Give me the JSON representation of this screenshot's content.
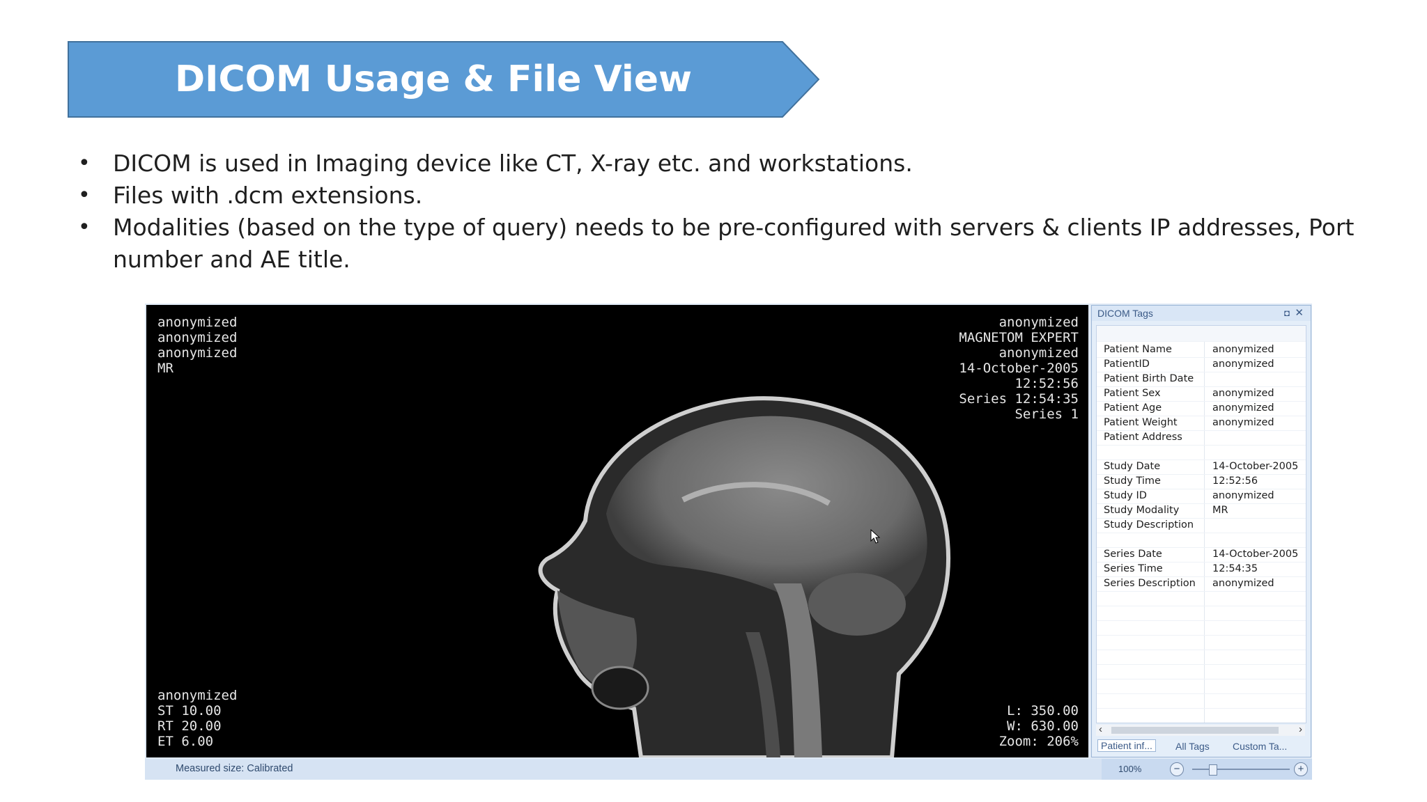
{
  "slide": {
    "title": "DICOM Usage & File View",
    "bullets": [
      "DICOM is used in Imaging device like CT, X-ray etc. and workstations.",
      "Files with .dcm extensions.",
      "Modalities (based on the type of query) needs to be pre-configured with servers & clients IP addresses, Port number and AE title."
    ],
    "banner_color": "#5b9bd5"
  },
  "viewer": {
    "overlay_top_left": "anonymized\nanonymized\nanonymized\nMR",
    "overlay_top_right": "anonymized\nMAGNETOM EXPERT\nanonymized\n14-October-2005\n12:52:56\nSeries 12:54:35\nSeries 1",
    "overlay_bottom_left": "anonymized\nST 10.00\nRT 20.00\nET 6.00",
    "overlay_bottom_right": "L: 350.00\nW: 630.00\nZoom: 206%",
    "status_text": "Measured size: Calibrated",
    "zoom_level": "100%"
  },
  "tags_panel": {
    "title": "DICOM Tags",
    "pin_icon": "pin-icon",
    "close_icon": "close-icon",
    "rows": [
      {
        "key": "Patient Name",
        "value": "anonymized"
      },
      {
        "key": "PatientID",
        "value": "anonymized"
      },
      {
        "key": "Patient Birth Date",
        "value": ""
      },
      {
        "key": "Patient Sex",
        "value": "anonymized"
      },
      {
        "key": "Patient Age",
        "value": "anonymized"
      },
      {
        "key": "Patient Weight",
        "value": "anonymized"
      },
      {
        "key": "Patient Address",
        "value": ""
      },
      {
        "key": "",
        "value": ""
      },
      {
        "key": "Study Date",
        "value": "14-October-2005"
      },
      {
        "key": "Study Time",
        "value": "12:52:56"
      },
      {
        "key": "Study ID",
        "value": "anonymized"
      },
      {
        "key": "Study Modality",
        "value": "MR"
      },
      {
        "key": "Study Description",
        "value": ""
      },
      {
        "key": "",
        "value": ""
      },
      {
        "key": "Series Date",
        "value": "14-October-2005"
      },
      {
        "key": "Series Time",
        "value": "12:54:35"
      },
      {
        "key": "Series Description",
        "value": "anonymized"
      }
    ],
    "tabs": [
      "Patient inf...",
      "All Tags",
      "Custom Ta..."
    ]
  }
}
